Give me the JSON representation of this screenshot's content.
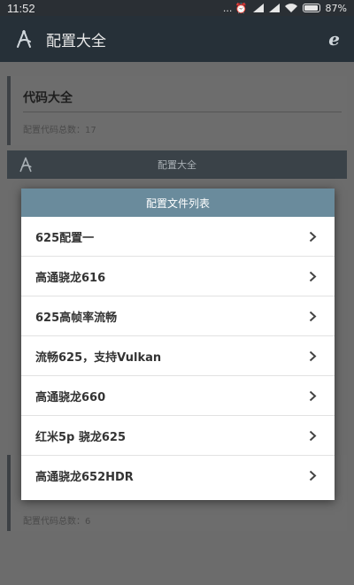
{
  "status_bar": {
    "time": "11:52",
    "icons": "... ⏰ ",
    "battery": "87%"
  },
  "app_bar": {
    "title": "配置大全",
    "logo_icon": "compass-icon",
    "browser_icon": "e"
  },
  "background": {
    "card_title": "代码大全",
    "card_count": "配置代码总数：17",
    "section_title": "配置大全",
    "bottom_count": "配置代码总数：6"
  },
  "dialog": {
    "title": "配置文件列表",
    "items": [
      {
        "label": "625配置一"
      },
      {
        "label": "高通骁龙616"
      },
      {
        "label": "625高帧率流畅"
      },
      {
        "label": "流畅625，支持Vulkan"
      },
      {
        "label": "高通骁龙660"
      },
      {
        "label": "红米5p 骁龙625"
      },
      {
        "label": "高通骁龙652HDR"
      }
    ]
  }
}
